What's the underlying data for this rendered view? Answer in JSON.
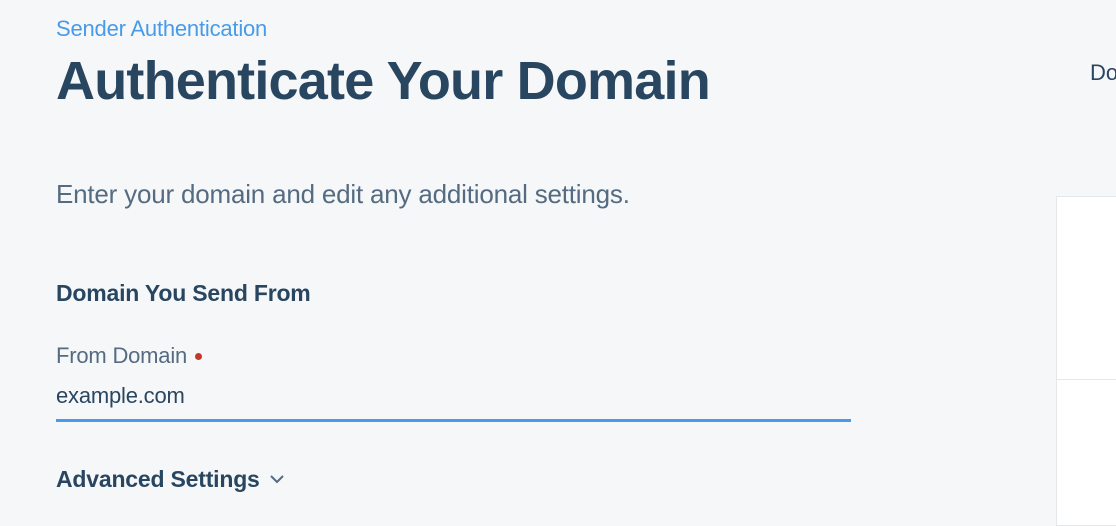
{
  "breadcrumb": {
    "label": "Sender Authentication"
  },
  "page": {
    "title": "Authenticate Your Domain",
    "instructions": "Enter your domain and edit any additional settings."
  },
  "form": {
    "section_title": "Domain You Send From",
    "from_domain": {
      "label": "From Domain",
      "value": "example.com"
    },
    "advanced": {
      "label": "Advanced Settings"
    }
  },
  "side": {
    "partial_text": "Do"
  }
}
